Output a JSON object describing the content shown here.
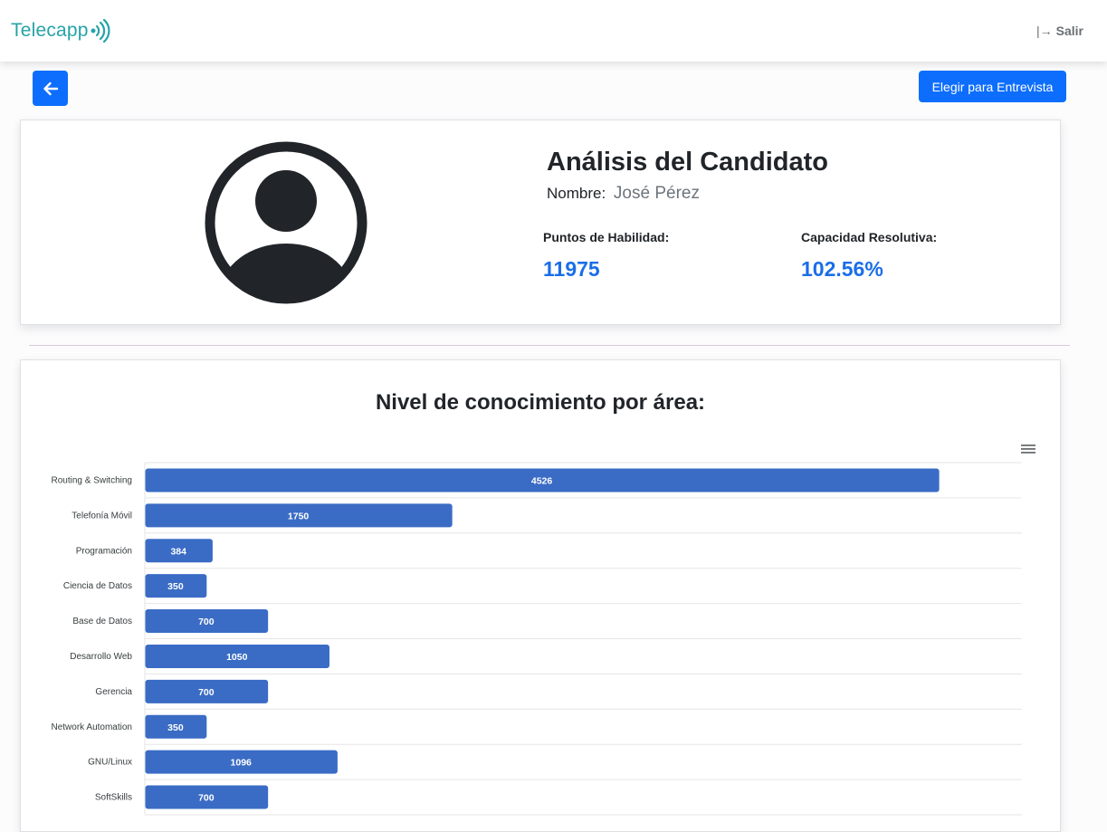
{
  "app": {
    "brand": "Telecapp",
    "logout_label": "Salir"
  },
  "actions": {
    "select_interview_label": "Elegir para Entrevista"
  },
  "candidate": {
    "title": "Análisis del Candidato",
    "name_label": "Nombre:",
    "name": "José Pérez",
    "skill_points_label": "Puntos de Habilidad:",
    "skill_points": "11975",
    "capacity_label": "Capacidad Resolutiva:",
    "capacity": "102.56%"
  },
  "chart": {
    "title": "Nivel de conocimiento por área:"
  },
  "chart_data": {
    "type": "bar",
    "orientation": "horizontal",
    "categories": [
      "Routing & Switching",
      "Telefonía Móvil",
      "Programación",
      "Ciencia de Datos",
      "Base de Datos",
      "Desarrollo Web",
      "Gerencia",
      "Network Automation",
      "GNU/Linux",
      "SoftSkills"
    ],
    "values": [
      4526,
      1750,
      384,
      350,
      700,
      1050,
      700,
      350,
      1096,
      700
    ],
    "xlim": [
      0,
      5000
    ],
    "grid": true,
    "data_labels": true,
    "bar_color": "#3a6cc5"
  },
  "colors": {
    "primary": "#0d6efd",
    "accent": "#1a6ee8",
    "brand": "#26a3a8"
  }
}
